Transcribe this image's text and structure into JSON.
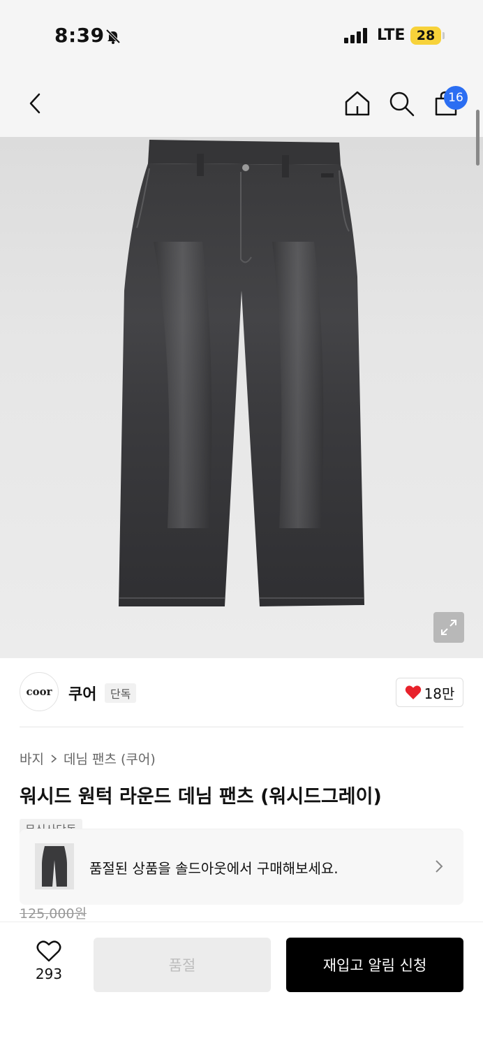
{
  "status_bar": {
    "time": "8:39",
    "network": "LTE",
    "battery": "28"
  },
  "nav": {
    "back_icon": "chevron-left-icon",
    "home_icon": "home-icon",
    "search_icon": "search-icon",
    "cart_icon": "bag-icon",
    "cart_count": "16"
  },
  "brand": {
    "logo_text": "coor",
    "name": "쿠어",
    "tag": "단독",
    "like_count": "18만"
  },
  "product": {
    "breadcrumb": [
      "바지",
      "데님 팬츠 (쿠어)"
    ],
    "title": "워시드 원턱 라운드 데님 팬츠 (워시드그레이)",
    "tag": "무신사단독",
    "original_price": "125,000원"
  },
  "soldout_banner": {
    "text": "품절된 상품을 솔드아웃에서 구매해보세요."
  },
  "bottom_bar": {
    "wish_count": "293",
    "soldout_label": "품절",
    "restock_label": "재입고 알림 신청"
  },
  "colors": {
    "badge_blue": "#2b6ef2",
    "battery_yellow": "#f7d23a",
    "heart_red": "#e8222b",
    "primary_black": "#000000"
  }
}
